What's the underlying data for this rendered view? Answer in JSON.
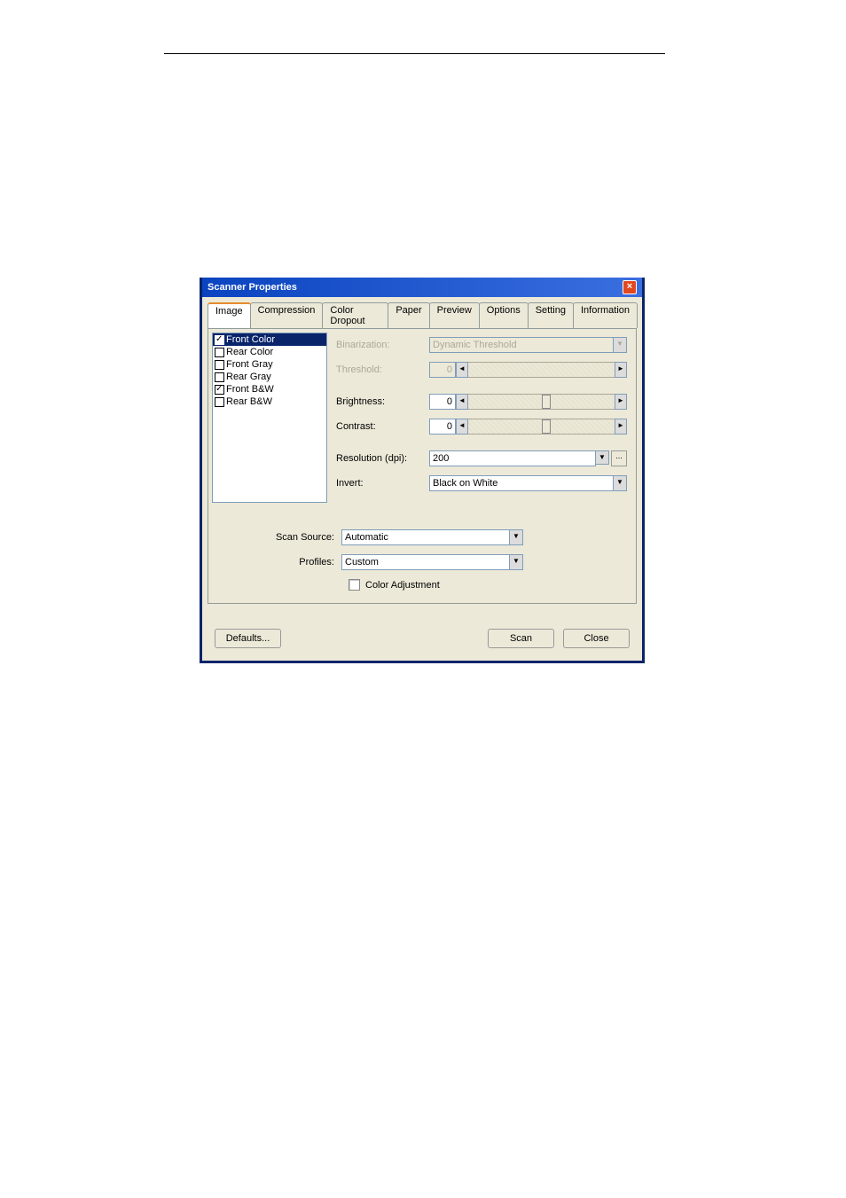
{
  "window": {
    "title": "Scanner Properties"
  },
  "tabs": [
    "Image",
    "Compression",
    "Color Dropout",
    "Paper",
    "Preview",
    "Options",
    "Setting",
    "Information"
  ],
  "activeTab": 0,
  "imageList": [
    {
      "label": "Front Color",
      "checked": true,
      "selected": true
    },
    {
      "label": "Rear Color",
      "checked": false,
      "selected": false
    },
    {
      "label": "Front Gray",
      "checked": false,
      "selected": false
    },
    {
      "label": "Rear Gray",
      "checked": false,
      "selected": false
    },
    {
      "label": "Front B&W",
      "checked": true,
      "selected": false
    },
    {
      "label": "Rear B&W",
      "checked": false,
      "selected": false
    }
  ],
  "settings": {
    "binarization": {
      "label": "Binarization:",
      "value": "Dynamic Threshold",
      "disabled": true
    },
    "threshold": {
      "label": "Threshold:",
      "value": "0",
      "disabled": true
    },
    "brightness": {
      "label": "Brightness:",
      "value": "0",
      "disabled": false
    },
    "contrast": {
      "label": "Contrast:",
      "value": "0",
      "disabled": false
    },
    "resolution": {
      "label": "Resolution (dpi):",
      "value": "200"
    },
    "invert": {
      "label": "Invert:",
      "value": "Black on White"
    }
  },
  "lower": {
    "scanSource": {
      "label": "Scan Source:",
      "value": "Automatic"
    },
    "profiles": {
      "label": "Profiles:",
      "value": "Custom"
    },
    "colorAdjustment": {
      "label": "Color Adjustment",
      "checked": false
    }
  },
  "buttons": {
    "defaults": "Defaults...",
    "scan": "Scan",
    "close": "Close"
  }
}
